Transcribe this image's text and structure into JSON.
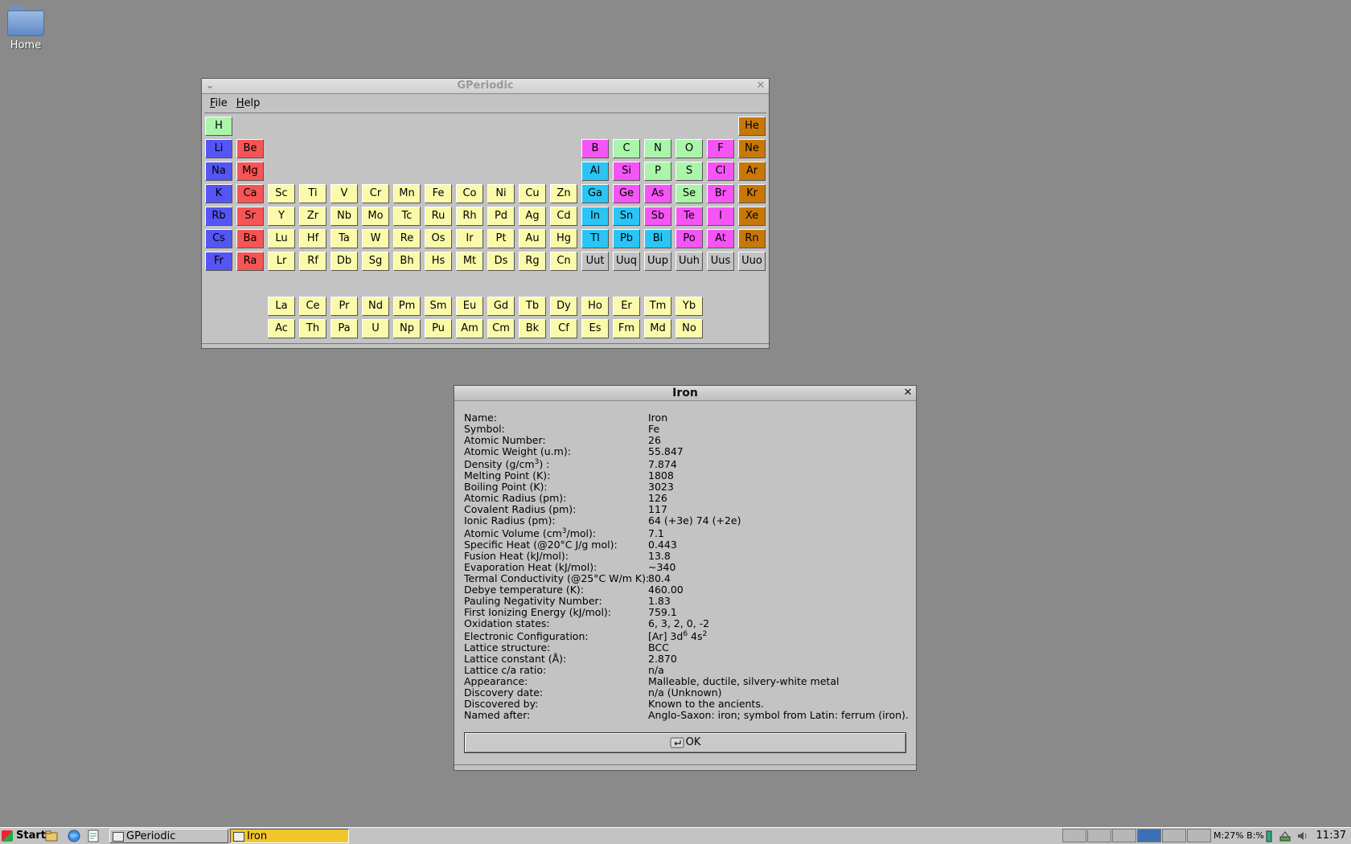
{
  "desktop": {
    "home_label": "Home"
  },
  "gperiodic": {
    "title": "GPeriodic",
    "menu": [
      "File",
      "Help"
    ],
    "colors": {
      "nonmetal": "#aaf5aa",
      "alkali": "#5555f5",
      "alkaline": "#f55555",
      "transition": "#fafaaa",
      "metalloid": "#f555f5",
      "other_metal": "#2ac5f5",
      "noble": "#c87808",
      "unknown": "#c3c3c3"
    },
    "rows": [
      [
        [
          "H",
          0,
          "nonmetal"
        ],
        [
          "He",
          17,
          "noble"
        ]
      ],
      [
        [
          "Li",
          0,
          "alkali"
        ],
        [
          "Be",
          1,
          "alkaline"
        ],
        [
          "B",
          12,
          "metalloid"
        ],
        [
          "C",
          13,
          "nonmetal"
        ],
        [
          "N",
          14,
          "nonmetal"
        ],
        [
          "O",
          15,
          "nonmetal"
        ],
        [
          "F",
          16,
          "metalloid"
        ],
        [
          "Ne",
          17,
          "noble"
        ]
      ],
      [
        [
          "Na",
          0,
          "alkali"
        ],
        [
          "Mg",
          1,
          "alkaline"
        ],
        [
          "Al",
          12,
          "other_metal"
        ],
        [
          "Si",
          13,
          "metalloid"
        ],
        [
          "P",
          14,
          "nonmetal"
        ],
        [
          "S",
          15,
          "nonmetal"
        ],
        [
          "Cl",
          16,
          "metalloid"
        ],
        [
          "Ar",
          17,
          "noble"
        ]
      ],
      [
        [
          "K",
          0,
          "alkali"
        ],
        [
          "Ca",
          1,
          "alkaline"
        ],
        [
          "Sc",
          2,
          "transition"
        ],
        [
          "Ti",
          3,
          "transition"
        ],
        [
          "V",
          4,
          "transition"
        ],
        [
          "Cr",
          5,
          "transition"
        ],
        [
          "Mn",
          6,
          "transition"
        ],
        [
          "Fe",
          7,
          "transition"
        ],
        [
          "Co",
          8,
          "transition"
        ],
        [
          "Ni",
          9,
          "transition"
        ],
        [
          "Cu",
          10,
          "transition"
        ],
        [
          "Zn",
          11,
          "transition"
        ],
        [
          "Ga",
          12,
          "other_metal"
        ],
        [
          "Ge",
          13,
          "metalloid"
        ],
        [
          "As",
          14,
          "metalloid"
        ],
        [
          "Se",
          15,
          "nonmetal"
        ],
        [
          "Br",
          16,
          "metalloid"
        ],
        [
          "Kr",
          17,
          "noble"
        ]
      ],
      [
        [
          "Rb",
          0,
          "alkali"
        ],
        [
          "Sr",
          1,
          "alkaline"
        ],
        [
          "Y",
          2,
          "transition"
        ],
        [
          "Zr",
          3,
          "transition"
        ],
        [
          "Nb",
          4,
          "transition"
        ],
        [
          "Mo",
          5,
          "transition"
        ],
        [
          "Tc",
          6,
          "transition"
        ],
        [
          "Ru",
          7,
          "transition"
        ],
        [
          "Rh",
          8,
          "transition"
        ],
        [
          "Pd",
          9,
          "transition"
        ],
        [
          "Ag",
          10,
          "transition"
        ],
        [
          "Cd",
          11,
          "transition"
        ],
        [
          "In",
          12,
          "other_metal"
        ],
        [
          "Sn",
          13,
          "other_metal"
        ],
        [
          "Sb",
          14,
          "metalloid"
        ],
        [
          "Te",
          15,
          "metalloid"
        ],
        [
          "I",
          16,
          "metalloid"
        ],
        [
          "Xe",
          17,
          "noble"
        ]
      ],
      [
        [
          "Cs",
          0,
          "alkali"
        ],
        [
          "Ba",
          1,
          "alkaline"
        ],
        [
          "Lu",
          2,
          "transition"
        ],
        [
          "Hf",
          3,
          "transition"
        ],
        [
          "Ta",
          4,
          "transition"
        ],
        [
          "W",
          5,
          "transition"
        ],
        [
          "Re",
          6,
          "transition"
        ],
        [
          "Os",
          7,
          "transition"
        ],
        [
          "Ir",
          8,
          "transition"
        ],
        [
          "Pt",
          9,
          "transition"
        ],
        [
          "Au",
          10,
          "transition"
        ],
        [
          "Hg",
          11,
          "transition"
        ],
        [
          "Tl",
          12,
          "other_metal"
        ],
        [
          "Pb",
          13,
          "other_metal"
        ],
        [
          "Bi",
          14,
          "other_metal"
        ],
        [
          "Po",
          15,
          "metalloid"
        ],
        [
          "At",
          16,
          "metalloid"
        ],
        [
          "Rn",
          17,
          "noble"
        ]
      ],
      [
        [
          "Fr",
          0,
          "alkali"
        ],
        [
          "Ra",
          1,
          "alkaline"
        ],
        [
          "Lr",
          2,
          "transition"
        ],
        [
          "Rf",
          3,
          "transition"
        ],
        [
          "Db",
          4,
          "transition"
        ],
        [
          "Sg",
          5,
          "transition"
        ],
        [
          "Bh",
          6,
          "transition"
        ],
        [
          "Hs",
          7,
          "transition"
        ],
        [
          "Mt",
          8,
          "transition"
        ],
        [
          "Ds",
          9,
          "transition"
        ],
        [
          "Rg",
          10,
          "transition"
        ],
        [
          "Cn",
          11,
          "transition"
        ],
        [
          "Uut",
          12,
          "unknown"
        ],
        [
          "Uuq",
          13,
          "unknown"
        ],
        [
          "Uup",
          14,
          "unknown"
        ],
        [
          "Uuh",
          15,
          "unknown"
        ],
        [
          "Uus",
          16,
          "unknown"
        ],
        [
          "Uuo",
          17,
          "unknown"
        ]
      ],
      [],
      [
        [
          "La",
          2,
          "transition"
        ],
        [
          "Ce",
          3,
          "transition"
        ],
        [
          "Pr",
          4,
          "transition"
        ],
        [
          "Nd",
          5,
          "transition"
        ],
        [
          "Pm",
          6,
          "transition"
        ],
        [
          "Sm",
          7,
          "transition"
        ],
        [
          "Eu",
          8,
          "transition"
        ],
        [
          "Gd",
          9,
          "transition"
        ],
        [
          "Tb",
          10,
          "transition"
        ],
        [
          "Dy",
          11,
          "transition"
        ],
        [
          "Ho",
          12,
          "transition"
        ],
        [
          "Er",
          13,
          "transition"
        ],
        [
          "Tm",
          14,
          "transition"
        ],
        [
          "Yb",
          15,
          "transition"
        ]
      ],
      [
        [
          "Ac",
          2,
          "transition"
        ],
        [
          "Th",
          3,
          "transition"
        ],
        [
          "Pa",
          4,
          "transition"
        ],
        [
          "U",
          5,
          "transition"
        ],
        [
          "Np",
          6,
          "transition"
        ],
        [
          "Pu",
          7,
          "transition"
        ],
        [
          "Am",
          8,
          "transition"
        ],
        [
          "Cm",
          9,
          "transition"
        ],
        [
          "Bk",
          10,
          "transition"
        ],
        [
          "Cf",
          11,
          "transition"
        ],
        [
          "Es",
          12,
          "transition"
        ],
        [
          "Fm",
          13,
          "transition"
        ],
        [
          "Md",
          14,
          "transition"
        ],
        [
          "No",
          15,
          "transition"
        ]
      ]
    ]
  },
  "dialog": {
    "title": "Iron",
    "properties": [
      {
        "key": "Name:",
        "value": "Iron"
      },
      {
        "key": "Symbol:",
        "value": "Fe"
      },
      {
        "key": "Atomic Number:",
        "value": "26"
      },
      {
        "key": "Atomic Weight (u.m):",
        "value": "55.847"
      },
      {
        "key": "Density (g/cm<sup>3</sup>) :",
        "value": "7.874",
        "tall": true
      },
      {
        "key": "Melting Point (K):",
        "value": "1808"
      },
      {
        "key": "Boiling Point (K):",
        "value": "3023"
      },
      {
        "key": "Atomic Radius (pm):",
        "value": "126"
      },
      {
        "key": "Covalent Radius (pm):",
        "value": "117"
      },
      {
        "key": "Ionic Radius (pm):",
        "value": "64 (+3e) 74 (+2e)"
      },
      {
        "key": "Atomic Volume (cm<sup>3</sup>/mol):",
        "value": "7.1",
        "tall": true
      },
      {
        "key": "Specific Heat (@20°C J/g mol):",
        "value": "0.443"
      },
      {
        "key": "Fusion Heat (kJ/mol):",
        "value": "13.8"
      },
      {
        "key": "Evaporation Heat (kJ/mol):",
        "value": "~340"
      },
      {
        "key": "Termal Conductivity (@25°C W/m K):",
        "value": "80.4"
      },
      {
        "key": "Debye temperature (K):",
        "value": "460.00"
      },
      {
        "key": "Pauling Negativity Number:",
        "value": "1.83"
      },
      {
        "key": "First Ionizing Energy (kJ/mol):",
        "value": "759.1"
      },
      {
        "key": "Oxidation states:",
        "value": "6, 3, 2, 0, -2"
      },
      {
        "key": "Electronic Configuration:",
        "value": "[Ar] 3d<sup>6</sup> 4s<sup>2</sup>",
        "tall": true
      },
      {
        "key": "Lattice structure:",
        "value": "BCC"
      },
      {
        "key": "Lattice constant (Å):",
        "value": "2.870"
      },
      {
        "key": "Lattice c/a ratio:",
        "value": "n/a"
      },
      {
        "key": "Appearance:",
        "value": "Malleable, ductile, silvery-white metal"
      },
      {
        "key": "Discovery date:",
        "value": "n/a (Unknown)"
      },
      {
        "key": "Discovered by:",
        "value": "Known to the ancients."
      },
      {
        "key": "Named after:",
        "value": "Anglo-Saxon: iron; symbol from Latin: ferrum (iron)."
      }
    ],
    "ok_label": "OK"
  },
  "taskbar": {
    "start_label": "Start",
    "tasks": [
      "GPeriodic",
      "Iron"
    ],
    "status": "M:27% B:%",
    "clock": "11:37"
  }
}
